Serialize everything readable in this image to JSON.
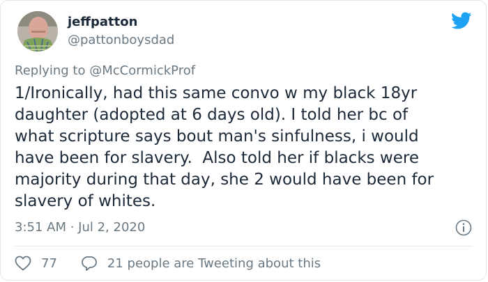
{
  "tweet": {
    "display_name": "jeffpatton",
    "handle": "@pattonboysdad",
    "replying_prefix": "Replying to ",
    "replying_to": "@McCormickProf",
    "text": "1/Ironically, had this same convo w my black 18yr\ndaughter (adopted at 6 days old). I told her bc of\nwhat scripture says bout man's sinfulness, i would\nhave been for slavery.  Also told her if blacks were\nmajority during that day, she 2 would have been for\nslavery of whites.",
    "timestamp": "3:51 AM · Jul 2, 2020",
    "likes": "77",
    "reply_summary": "21 people are Tweeting about this"
  },
  "icons": {
    "brand": "twitter-bird-icon",
    "info": "info-icon",
    "like": "heart-icon",
    "reply": "speech-bubble-icon"
  },
  "colors": {
    "brand": "#1da1f2",
    "text": "#1c2938",
    "muted": "#697882",
    "border": "#e1e8ed"
  }
}
